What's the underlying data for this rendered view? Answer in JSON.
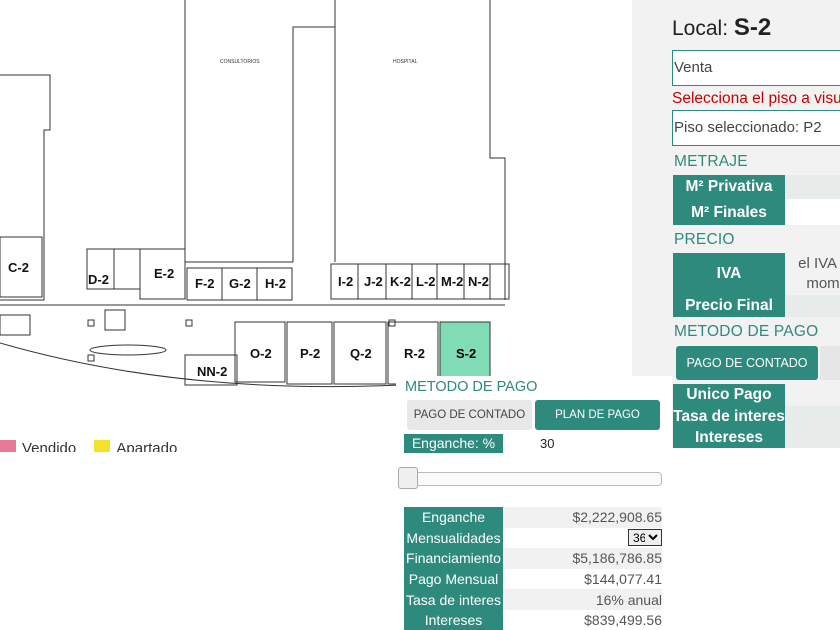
{
  "floorplan": {
    "building_labels": [
      "CONSULTORIOS",
      "HOSPITAL"
    ],
    "units": [
      "C-2",
      "D-2",
      "E-2",
      "F-2",
      "G-2",
      "H-2",
      "I-2",
      "J-2",
      "K-2",
      "L-2",
      "M-2",
      "N-2",
      "NN-2",
      "O-2",
      "P-2",
      "Q-2",
      "R-2",
      "S-2"
    ],
    "selected_unit": "S-2",
    "selected_color": "#7fdcb4",
    "legend": [
      "Vendido",
      "Apartado"
    ],
    "legend_colors": [
      "#e77a96",
      "#f2e22a"
    ]
  },
  "info": {
    "title_prefix": "Local:",
    "title_value": "S-2",
    "status_value": "Venta",
    "floor_prompt": "Selecciona el piso a visualizar",
    "floor_value": "Piso seleccionado: P2",
    "section_metraje": "METRAJE",
    "m2_privativa": "M² Privativa",
    "m2_finales": "M² Finales",
    "section_precio": "PRECIO",
    "iva_label": "IVA",
    "iva_note_line1": "el IVA s",
    "iva_note_line2": "mom",
    "precio_final_label": "Precio Final",
    "section_metodo": "METODO DE PAGO",
    "pago_contado_button": "PAGO DE CONTADO",
    "unico_pago_line1": "Unico Pago",
    "unico_pago_line2": "Tasa de interes",
    "intereses_label": "Intereses"
  },
  "payment": {
    "heading": "METODO DE PAGO",
    "contado_button": "PAGO DE CONTADO",
    "plan_button": "PLAN DE PAGO",
    "enganche_pct_label": "Enganche: %",
    "enganche_pct_value": "30",
    "slider_value_fraction": 0.0,
    "rows": [
      {
        "label": "Enganche",
        "value": "$2,222,908.65"
      },
      {
        "label": "Mensualidades",
        "value": "36"
      },
      {
        "label": "Financiamiento",
        "value": "$5,186,786.85"
      },
      {
        "label": "Pago Mensual",
        "value": "$144,077.41"
      },
      {
        "label": "Tasa de interes",
        "value": "16% anual"
      },
      {
        "label": "Intereses",
        "value": "$839,499.56"
      }
    ],
    "mensualidades_options": [
      "36"
    ]
  },
  "colors": {
    "accent": "#2e8a7c",
    "warning": "#c40000"
  }
}
